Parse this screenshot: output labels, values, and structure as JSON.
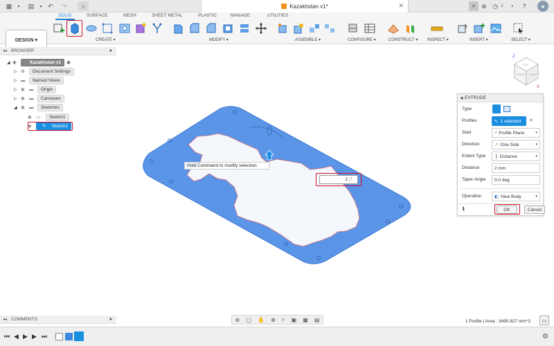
{
  "titlebar": {
    "doc_title": "Kazakhstan v1*",
    "notification_count": "1"
  },
  "ribbon": {
    "tabs": [
      "SOLID",
      "SURFACE",
      "MESH",
      "SHEET METAL",
      "PLASTIC",
      "MANAGE",
      "UTILITIES"
    ],
    "workspace": "DESIGN",
    "groups": [
      "CREATE",
      "MODIFY",
      "ASSEMBLE",
      "CONFIGURE",
      "CONSTRUCT",
      "INSPECT",
      "INSERT",
      "SELECT"
    ]
  },
  "browser": {
    "title": "BROWSER",
    "root": "Kazakhstan v1",
    "items": [
      "Document Settings",
      "Named Views",
      "Origin",
      "Canvases",
      "Sketches",
      "Sketch1",
      "Sketch2"
    ]
  },
  "canvas": {
    "tooltip": "Hold Command to modify selection",
    "distance_input": "2"
  },
  "extrude": {
    "title": "EXTRUDE",
    "rows": [
      {
        "key": "Type",
        "value": ""
      },
      {
        "key": "Profiles",
        "value": "1 selected"
      },
      {
        "key": "Start",
        "value": "Profile Plane"
      },
      {
        "key": "Direction",
        "value": "One Side"
      },
      {
        "key": "Extent Type",
        "value": "Distance"
      },
      {
        "key": "Distance",
        "value": "2 mm"
      },
      {
        "key": "Taper Angle",
        "value": "0.0 deg"
      },
      {
        "key": "Operation",
        "value": "New Body"
      }
    ],
    "ok_label": "OK",
    "cancel_label": "Cancel"
  },
  "viewcube": {
    "top": "TOP",
    "front": "FRONT",
    "right": "RIGHT"
  },
  "comments_label": "COMMENTS",
  "status_text": "1 Profile | Area : 3490.827 mm^2",
  "colors": {
    "accent": "#1a8fe0",
    "highlight": "#d0102a",
    "plate": "#5b95e8"
  }
}
